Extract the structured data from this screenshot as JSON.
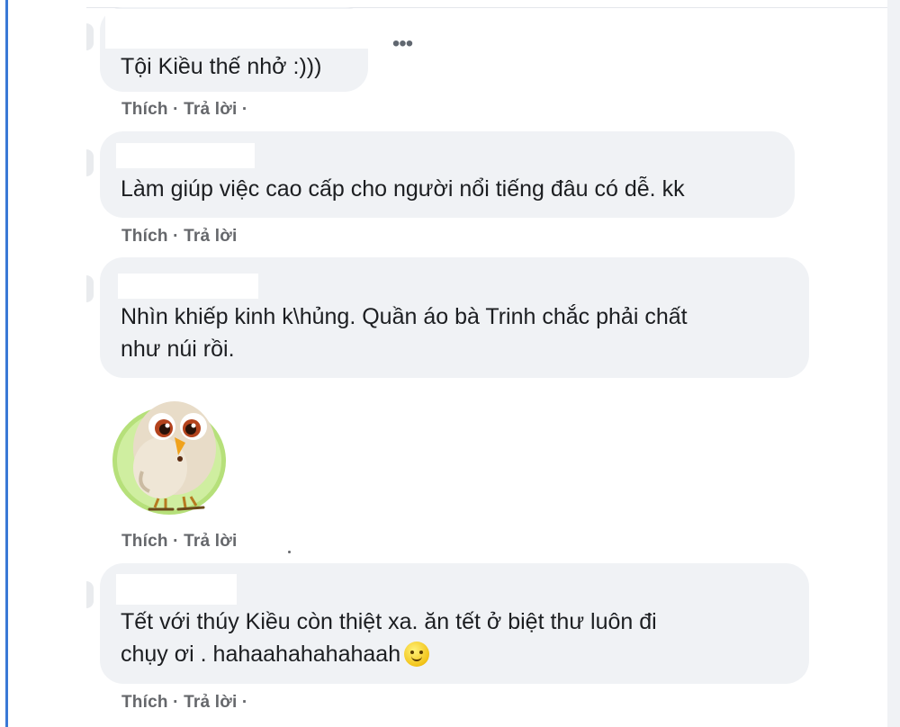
{
  "comments": [
    {
      "text": "Tội Kiều thế nhở :)))",
      "actions": {
        "like": "Thích",
        "separator": " · ",
        "reply": "Trả lời",
        "trailing": " ·"
      }
    },
    {
      "text": "Làm giúp việc cao cấp cho người nổi tiếng đâu có dễ. kk",
      "actions": {
        "like": "Thích",
        "separator": " · ",
        "reply": "Trả lời",
        "trailing": ""
      }
    },
    {
      "text": "Nhìn khiếp kinh k\\hủng. Quần áo bà Trinh chắc phải chất\nnhư núi rồi.",
      "actions": {
        "like": "Thích",
        "separator": " · ",
        "reply": "Trả lời",
        "trailing": ""
      }
    },
    {
      "sticker": "chick-sticker",
      "actions": {
        "like": "Thích",
        "separator": " · ",
        "reply": "Trả lời",
        "trailing": ""
      }
    },
    {
      "text": "Tết với thúy Kiều còn thiệt xa. ăn tết ở biệt thư luôn đi\nchụy ơi . hahaahahahahaah",
      "emoji": "smile-emoji",
      "actions": {
        "like": "Thích",
        "separator": " · ",
        "reply": "Trả lời",
        "trailing": " ·"
      }
    }
  ],
  "more_menu": {
    "label": "•••"
  },
  "colors": {
    "bubble": "#f0f2f5",
    "text": "#1c1e21",
    "action": "#65676b",
    "accent_rule": "#3a79d6"
  }
}
